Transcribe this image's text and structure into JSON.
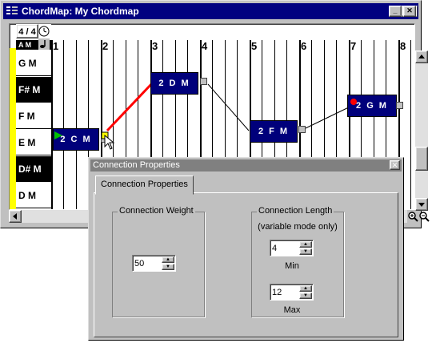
{
  "window": {
    "title": "ChordMap: My Chordmap",
    "minimize_glyph": "_",
    "maximize_glyph": "□",
    "close_glyph": "✕"
  },
  "editor": {
    "time_signature": "4 / 4",
    "top_clipped_label": "A M",
    "notes": [
      {
        "label": "G M",
        "shade": "white"
      },
      {
        "label": "F# M",
        "shade": "black"
      },
      {
        "label": "F M",
        "shade": "white"
      },
      {
        "label": "E M",
        "shade": "white"
      },
      {
        "label": "D# M",
        "shade": "black"
      },
      {
        "label": "D M",
        "shade": "white"
      }
    ],
    "measures": [
      "1",
      "2",
      "3",
      "4",
      "5",
      "6",
      "7",
      "8"
    ],
    "chords": [
      {
        "label": "2 C M",
        "marker": "start-arrow"
      },
      {
        "label": "2 D M",
        "marker": "none"
      },
      {
        "label": "2 F M",
        "marker": "none"
      },
      {
        "label": "2 G M",
        "marker": "end-dot"
      }
    ],
    "colors": {
      "chord_fill": "#00007b",
      "selected_connection": "#ff0000",
      "key_strip": "#ffff00",
      "start_marker": "#00c000",
      "end_marker": "#ff0000"
    }
  },
  "dialog": {
    "title": "Connection Properties",
    "close_glyph": "✕",
    "tab_label": "Connection Properties",
    "weight_group": "Connection Weight",
    "weight_value": "50",
    "length_group": "Connection Length",
    "length_sub": "(variable mode only)",
    "min_value": "4",
    "min_label": "Min",
    "max_value": "12",
    "max_label": "Max"
  }
}
